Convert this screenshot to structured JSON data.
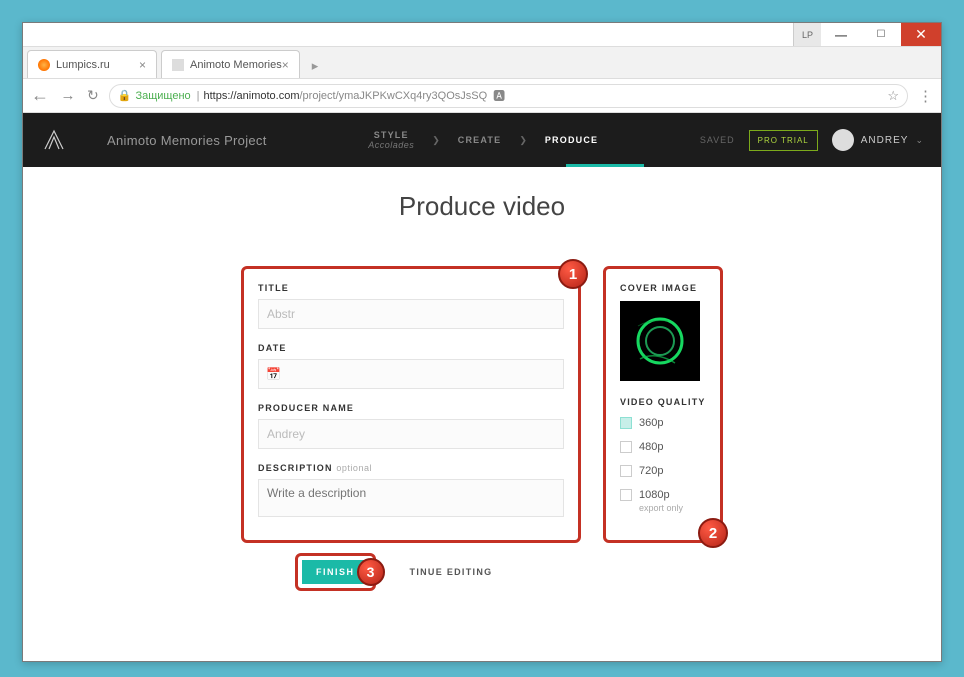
{
  "browser": {
    "tabs": [
      {
        "title": "Lumpics.ru"
      },
      {
        "title": "Animoto Memories"
      }
    ],
    "secure_label": "Защищено",
    "url_host": "https://animoto.com",
    "url_path": "/project/ymaJKPKwCXq4ry3QOsJsSQ"
  },
  "header": {
    "project_name": "Animoto Memories Project",
    "steps": [
      {
        "label": "STYLE",
        "sub": "Accolades"
      },
      {
        "label": "CREATE",
        "sub": ""
      },
      {
        "label": "PRODUCE",
        "sub": ""
      }
    ],
    "saved": "SAVED",
    "pro_trial": "PRO TRIAL",
    "username": "ANDREY"
  },
  "page": {
    "title": "Produce video"
  },
  "form": {
    "title_label": "TITLE",
    "title_value": "Abstr",
    "date_label": "DATE",
    "date_value": "",
    "producer_label": "PRODUCER NAME",
    "producer_value": "Andrey",
    "description_label": "DESCRIPTION",
    "description_optional": "optional",
    "description_placeholder": "Write a description"
  },
  "sidebar": {
    "cover_label": "COVER IMAGE",
    "quality_label": "VIDEO QUALITY",
    "qualities": [
      {
        "label": "360p"
      },
      {
        "label": "480p"
      },
      {
        "label": "720p"
      },
      {
        "label": "1080p"
      }
    ],
    "export_only": "export only"
  },
  "actions": {
    "finish": "FINISH",
    "continue": "TINUE EDITING"
  },
  "badges": {
    "b1": "1",
    "b2": "2",
    "b3": "3"
  }
}
